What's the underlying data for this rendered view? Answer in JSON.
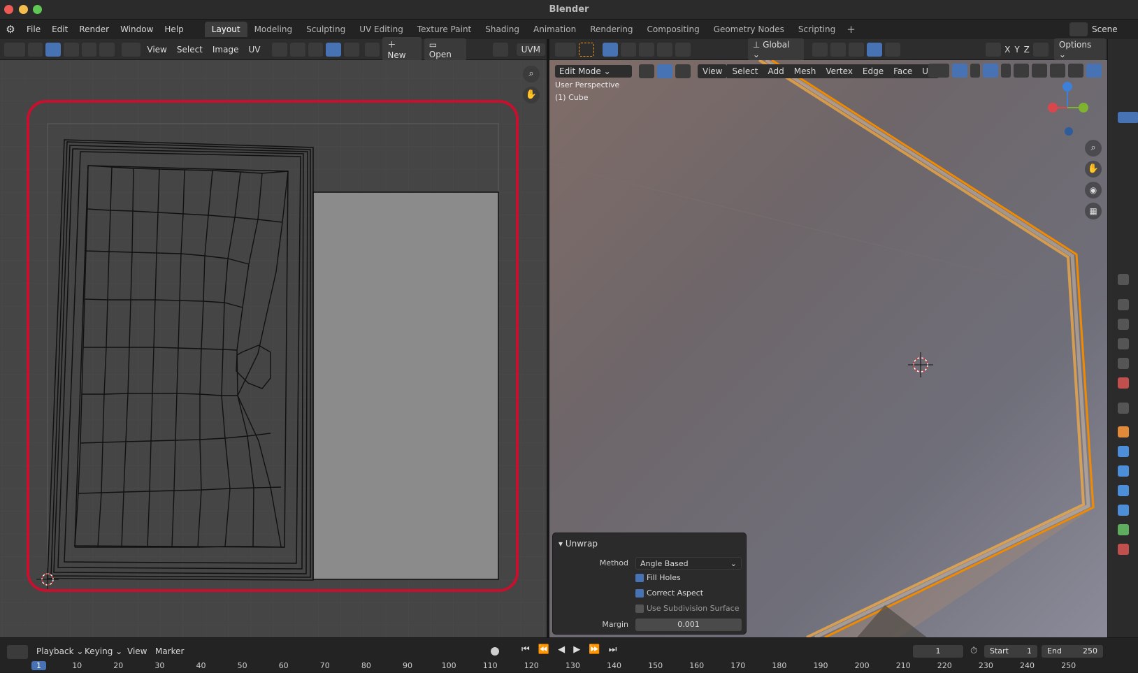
{
  "window": {
    "title": "Blender"
  },
  "menu": [
    "File",
    "Edit",
    "Render",
    "Window",
    "Help"
  ],
  "workspaces": [
    "Layout",
    "Modeling",
    "Sculpting",
    "UV Editing",
    "Texture Paint",
    "Shading",
    "Animation",
    "Rendering",
    "Compositing",
    "Geometry Nodes",
    "Scripting"
  ],
  "scene_label": "Scene",
  "uv_header": {
    "view": "View",
    "select": "Select",
    "image": "Image",
    "uv": "UV",
    "new": "New",
    "open": "Open",
    "uvmap": "UVM"
  },
  "v3d_header": {
    "transform": "Global",
    "options": "Options",
    "axes": [
      "X",
      "Y",
      "Z"
    ]
  },
  "v3d_header2": {
    "mode": "Edit Mode",
    "menus": [
      "View",
      "Select",
      "Add",
      "Mesh",
      "Vertex",
      "Edge",
      "Face",
      "UV"
    ]
  },
  "overlay": {
    "perspective": "User Perspective",
    "object": "(1) Cube"
  },
  "unwrap": {
    "title": "Unwrap",
    "method_label": "Method",
    "method_value": "Angle Based",
    "fill_holes": "Fill Holes",
    "correct_aspect": "Correct Aspect",
    "use_subsurf": "Use Subdivision Surface",
    "margin_label": "Margin",
    "margin_value": "0.001"
  },
  "timeline": {
    "playback": "Playback",
    "keying": "Keying",
    "view": "View",
    "marker": "Marker",
    "current_frame": "1",
    "start_label": "Start",
    "start_value": "1",
    "end_label": "End",
    "end_value": "250",
    "ticks": [
      "1",
      "10",
      "20",
      "30",
      "40",
      "50",
      "60",
      "70",
      "80",
      "90",
      "100",
      "110",
      "120",
      "130",
      "140",
      "150",
      "160",
      "170",
      "180",
      "190",
      "200",
      "210",
      "220",
      "230",
      "240",
      "250"
    ]
  },
  "colors": {
    "accent": "#4772b3",
    "highlight": "#c8102e",
    "selection_edge": "#f08a00"
  }
}
